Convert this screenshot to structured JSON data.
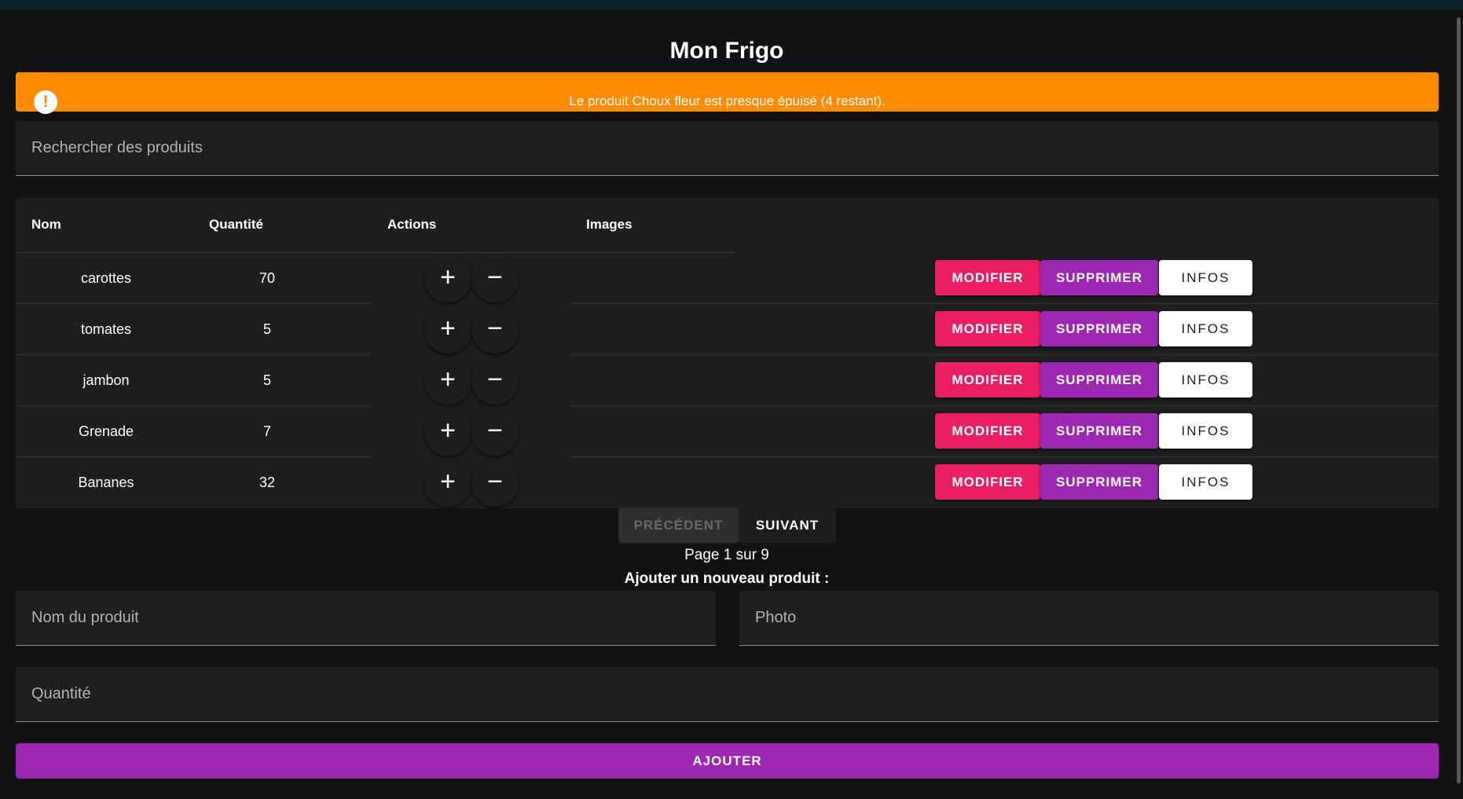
{
  "app": {
    "title": "Mon Frigo"
  },
  "alert": {
    "icon": "exclamation-circle-icon",
    "icon_glyph": "!",
    "message": "Le produit Choux fleur est presque épuisé (4 restant).",
    "color": "#ff8c00"
  },
  "search": {
    "placeholder": "Rechercher des produits",
    "value": ""
  },
  "table": {
    "headers": {
      "name": "Nom",
      "quantity": "Quantité",
      "actions": "Actions",
      "images": "Images"
    },
    "rows": [
      {
        "name": "carottes",
        "quantity": "70"
      },
      {
        "name": "tomates",
        "quantity": "5"
      },
      {
        "name": "jambon",
        "quantity": "5"
      },
      {
        "name": "Grenade",
        "quantity": "7"
      },
      {
        "name": "Bananes",
        "quantity": "32"
      }
    ],
    "increment_glyph": "+",
    "decrement_glyph": "−",
    "modify_label": "MODIFIER",
    "delete_label": "SUPPRIMER",
    "info_label": "INFOS"
  },
  "pagination": {
    "prev_label": "PRÉCÉDENT",
    "next_label": "SUIVANT",
    "page_text": "Page 1 sur 9",
    "current_page": 1,
    "total_pages": 9
  },
  "add_form": {
    "title": "Ajouter un nouveau produit :",
    "name_placeholder": "Nom du produit",
    "photo_placeholder": "Photo",
    "quantity_placeholder": "Quantité",
    "submit_label": "AJOUTER"
  },
  "colors": {
    "background": "#121212",
    "surface": "#1e1e1e",
    "modify": "#e91e63",
    "delete": "#9c27b0",
    "info": "#ffffff",
    "add": "#9c27b0",
    "alert": "#ff8c00"
  }
}
